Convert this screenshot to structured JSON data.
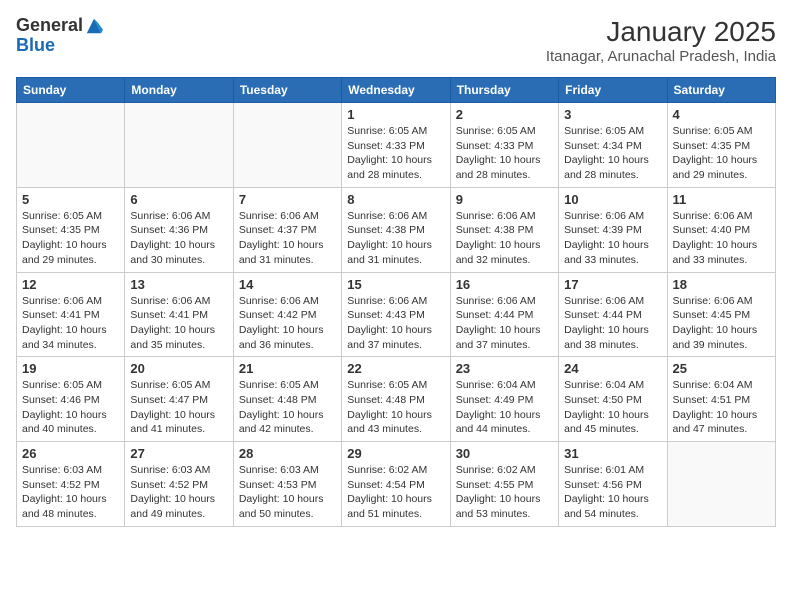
{
  "header": {
    "logo_general": "General",
    "logo_blue": "Blue",
    "title": "January 2025",
    "subtitle": "Itanagar, Arunachal Pradesh, India"
  },
  "weekdays": [
    "Sunday",
    "Monday",
    "Tuesday",
    "Wednesday",
    "Thursday",
    "Friday",
    "Saturday"
  ],
  "weeks": [
    [
      {
        "day": "",
        "info": ""
      },
      {
        "day": "",
        "info": ""
      },
      {
        "day": "",
        "info": ""
      },
      {
        "day": "1",
        "info": "Sunrise: 6:05 AM\nSunset: 4:33 PM\nDaylight: 10 hours\nand 28 minutes."
      },
      {
        "day": "2",
        "info": "Sunrise: 6:05 AM\nSunset: 4:33 PM\nDaylight: 10 hours\nand 28 minutes."
      },
      {
        "day": "3",
        "info": "Sunrise: 6:05 AM\nSunset: 4:34 PM\nDaylight: 10 hours\nand 28 minutes."
      },
      {
        "day": "4",
        "info": "Sunrise: 6:05 AM\nSunset: 4:35 PM\nDaylight: 10 hours\nand 29 minutes."
      }
    ],
    [
      {
        "day": "5",
        "info": "Sunrise: 6:05 AM\nSunset: 4:35 PM\nDaylight: 10 hours\nand 29 minutes."
      },
      {
        "day": "6",
        "info": "Sunrise: 6:06 AM\nSunset: 4:36 PM\nDaylight: 10 hours\nand 30 minutes."
      },
      {
        "day": "7",
        "info": "Sunrise: 6:06 AM\nSunset: 4:37 PM\nDaylight: 10 hours\nand 31 minutes."
      },
      {
        "day": "8",
        "info": "Sunrise: 6:06 AM\nSunset: 4:38 PM\nDaylight: 10 hours\nand 31 minutes."
      },
      {
        "day": "9",
        "info": "Sunrise: 6:06 AM\nSunset: 4:38 PM\nDaylight: 10 hours\nand 32 minutes."
      },
      {
        "day": "10",
        "info": "Sunrise: 6:06 AM\nSunset: 4:39 PM\nDaylight: 10 hours\nand 33 minutes."
      },
      {
        "day": "11",
        "info": "Sunrise: 6:06 AM\nSunset: 4:40 PM\nDaylight: 10 hours\nand 33 minutes."
      }
    ],
    [
      {
        "day": "12",
        "info": "Sunrise: 6:06 AM\nSunset: 4:41 PM\nDaylight: 10 hours\nand 34 minutes."
      },
      {
        "day": "13",
        "info": "Sunrise: 6:06 AM\nSunset: 4:41 PM\nDaylight: 10 hours\nand 35 minutes."
      },
      {
        "day": "14",
        "info": "Sunrise: 6:06 AM\nSunset: 4:42 PM\nDaylight: 10 hours\nand 36 minutes."
      },
      {
        "day": "15",
        "info": "Sunrise: 6:06 AM\nSunset: 4:43 PM\nDaylight: 10 hours\nand 37 minutes."
      },
      {
        "day": "16",
        "info": "Sunrise: 6:06 AM\nSunset: 4:44 PM\nDaylight: 10 hours\nand 37 minutes."
      },
      {
        "day": "17",
        "info": "Sunrise: 6:06 AM\nSunset: 4:44 PM\nDaylight: 10 hours\nand 38 minutes."
      },
      {
        "day": "18",
        "info": "Sunrise: 6:06 AM\nSunset: 4:45 PM\nDaylight: 10 hours\nand 39 minutes."
      }
    ],
    [
      {
        "day": "19",
        "info": "Sunrise: 6:05 AM\nSunset: 4:46 PM\nDaylight: 10 hours\nand 40 minutes."
      },
      {
        "day": "20",
        "info": "Sunrise: 6:05 AM\nSunset: 4:47 PM\nDaylight: 10 hours\nand 41 minutes."
      },
      {
        "day": "21",
        "info": "Sunrise: 6:05 AM\nSunset: 4:48 PM\nDaylight: 10 hours\nand 42 minutes."
      },
      {
        "day": "22",
        "info": "Sunrise: 6:05 AM\nSunset: 4:48 PM\nDaylight: 10 hours\nand 43 minutes."
      },
      {
        "day": "23",
        "info": "Sunrise: 6:04 AM\nSunset: 4:49 PM\nDaylight: 10 hours\nand 44 minutes."
      },
      {
        "day": "24",
        "info": "Sunrise: 6:04 AM\nSunset: 4:50 PM\nDaylight: 10 hours\nand 45 minutes."
      },
      {
        "day": "25",
        "info": "Sunrise: 6:04 AM\nSunset: 4:51 PM\nDaylight: 10 hours\nand 47 minutes."
      }
    ],
    [
      {
        "day": "26",
        "info": "Sunrise: 6:03 AM\nSunset: 4:52 PM\nDaylight: 10 hours\nand 48 minutes."
      },
      {
        "day": "27",
        "info": "Sunrise: 6:03 AM\nSunset: 4:52 PM\nDaylight: 10 hours\nand 49 minutes."
      },
      {
        "day": "28",
        "info": "Sunrise: 6:03 AM\nSunset: 4:53 PM\nDaylight: 10 hours\nand 50 minutes."
      },
      {
        "day": "29",
        "info": "Sunrise: 6:02 AM\nSunset: 4:54 PM\nDaylight: 10 hours\nand 51 minutes."
      },
      {
        "day": "30",
        "info": "Sunrise: 6:02 AM\nSunset: 4:55 PM\nDaylight: 10 hours\nand 53 minutes."
      },
      {
        "day": "31",
        "info": "Sunrise: 6:01 AM\nSunset: 4:56 PM\nDaylight: 10 hours\nand 54 minutes."
      },
      {
        "day": "",
        "info": ""
      }
    ]
  ]
}
